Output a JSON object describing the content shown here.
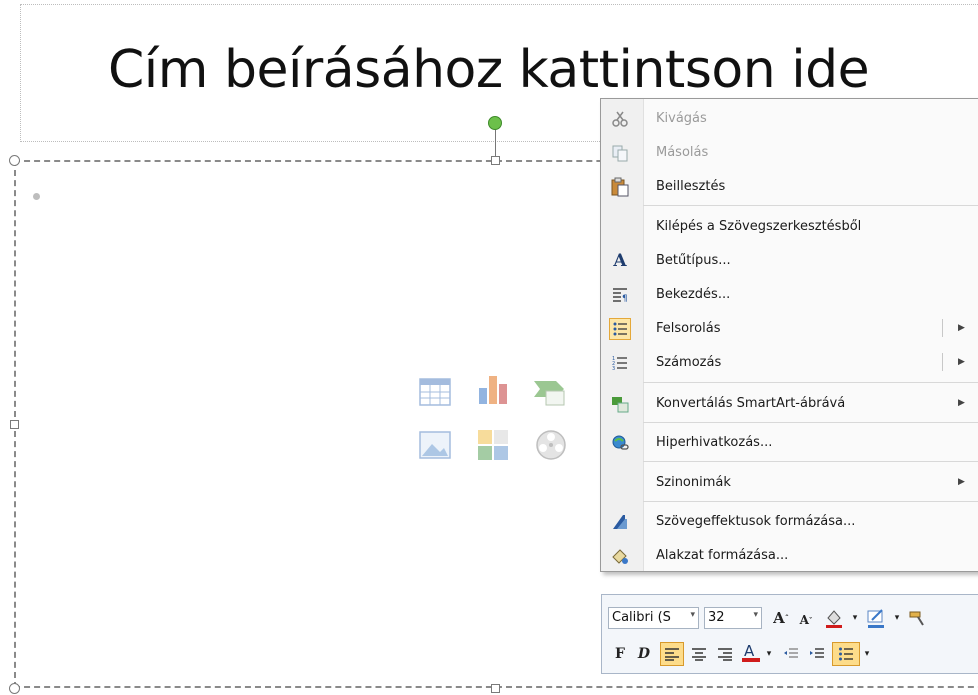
{
  "slide": {
    "title_placeholder": "Cím beírásához kattintson ide"
  },
  "context_menu": {
    "items": [
      {
        "label": "Kivágás",
        "icon": "scissors-icon",
        "enabled": false
      },
      {
        "label": "Másolás",
        "icon": "copy-icon",
        "enabled": false
      },
      {
        "label": "Beillesztés",
        "icon": "paste-icon",
        "enabled": true
      },
      {
        "label": "Kilépés a Szövegszerkesztésből",
        "icon": "",
        "enabled": true
      },
      {
        "label": "Betűtípus...",
        "icon": "font-icon",
        "enabled": true
      },
      {
        "label": "Bekezdés...",
        "icon": "paragraph-icon",
        "enabled": true
      },
      {
        "label": "Felsorolás",
        "icon": "bullets-icon",
        "enabled": true,
        "submenu": true
      },
      {
        "label": "Számozás",
        "icon": "numbering-icon",
        "enabled": true,
        "submenu": true
      },
      {
        "label": "Konvertálás SmartArt-ábrává",
        "icon": "smartart-icon",
        "enabled": true,
        "submenu": true
      },
      {
        "label": "Hiperhivatkozás...",
        "icon": "hyperlink-icon",
        "enabled": true
      },
      {
        "label": "Szinonimák",
        "icon": "",
        "enabled": true,
        "submenu": true
      },
      {
        "label": "Szövegeffektusok formázása...",
        "icon": "text-effects-icon",
        "enabled": true
      },
      {
        "label": "Alakzat formázása...",
        "icon": "format-shape-icon",
        "enabled": true
      }
    ]
  },
  "mini_toolbar": {
    "font_name": "Calibri (S",
    "font_size": "32",
    "bold": "F",
    "italic": "D"
  },
  "colors": {
    "font_color_underline": "#d01c1c",
    "highlight": "#fddc8a",
    "rotation_handle": "#6cc04a"
  }
}
